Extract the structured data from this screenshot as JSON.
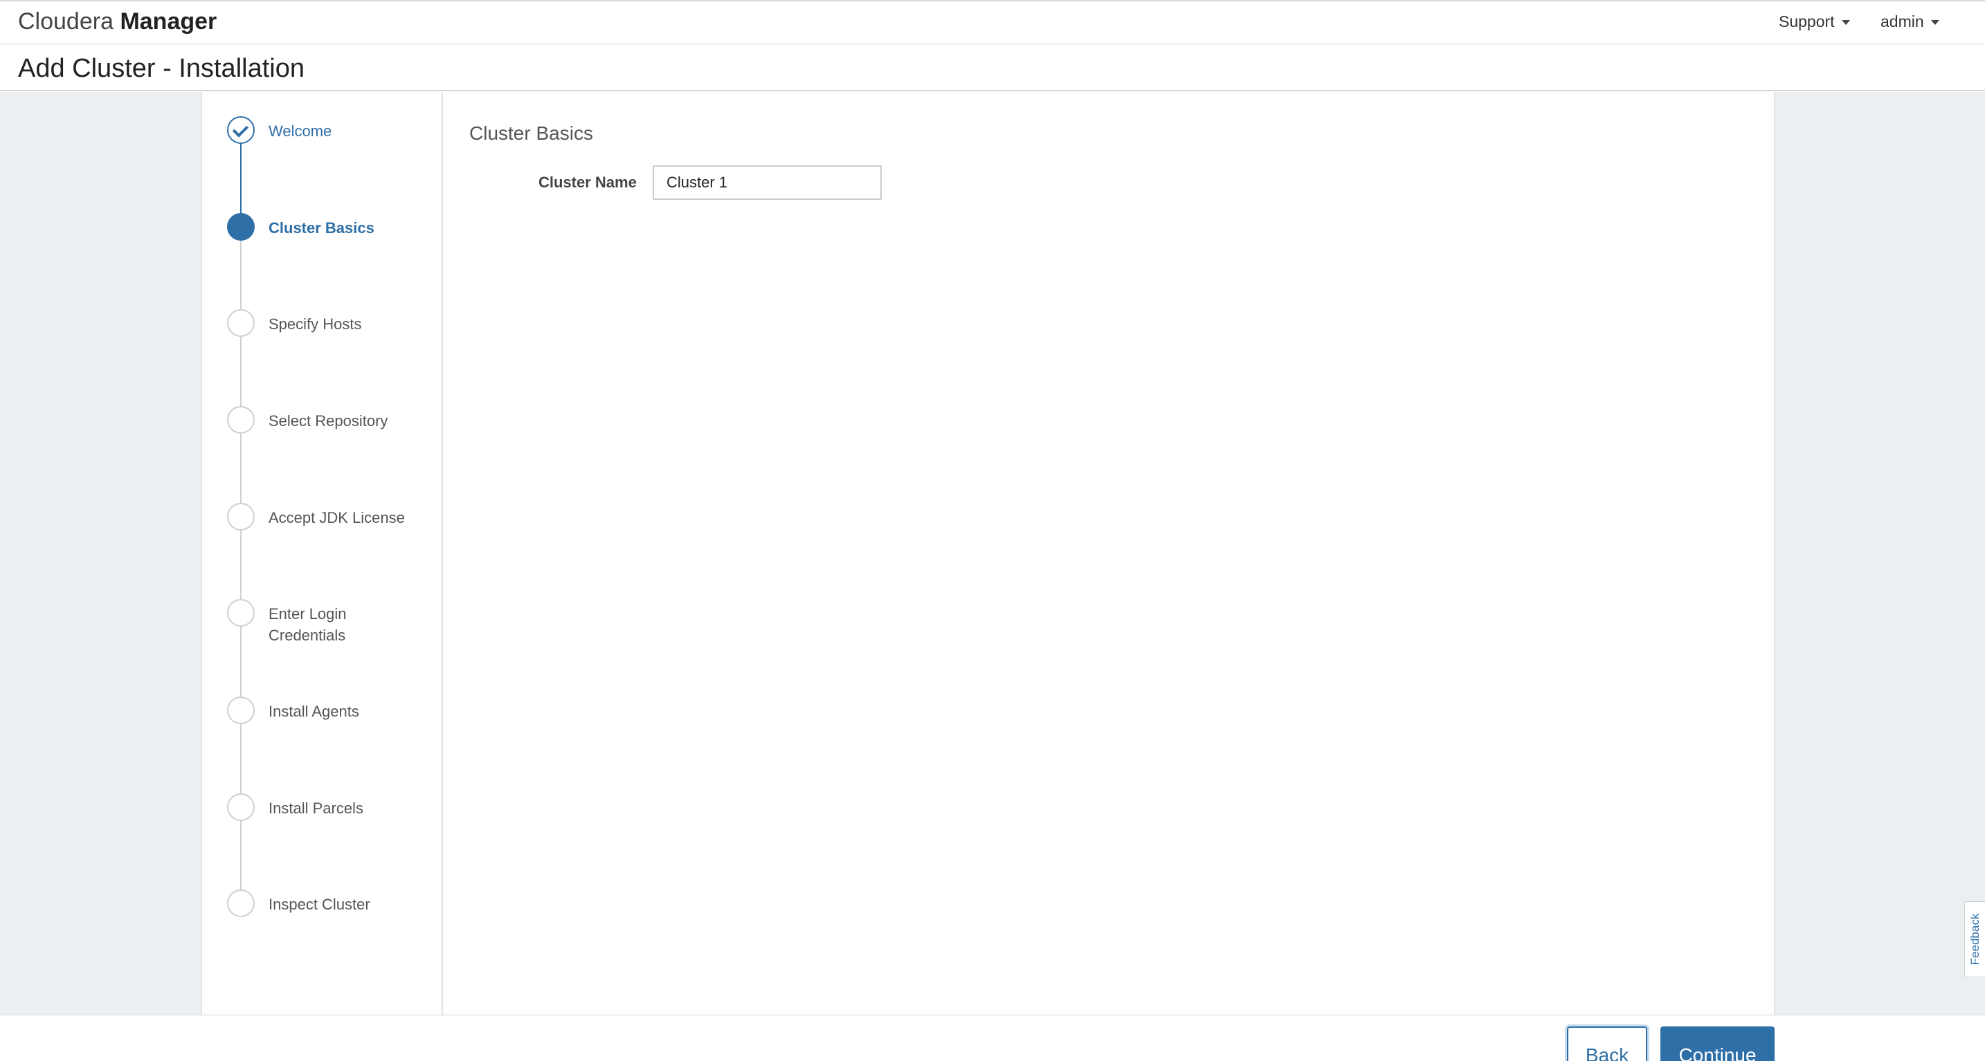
{
  "header": {
    "brand_light": "Cloudera",
    "brand_bold": "Manager",
    "support_label": "Support",
    "user_label": "admin"
  },
  "page_title": "Add Cluster - Installation",
  "wizard": {
    "steps": [
      {
        "label": "Welcome",
        "state": "done"
      },
      {
        "label": "Cluster Basics",
        "state": "active"
      },
      {
        "label": "Specify Hosts",
        "state": "pending"
      },
      {
        "label": "Select Repository",
        "state": "pending"
      },
      {
        "label": "Accept JDK License",
        "state": "pending"
      },
      {
        "label": "Enter Login Credentials",
        "state": "pending"
      },
      {
        "label": "Install Agents",
        "state": "pending"
      },
      {
        "label": "Install Parcels",
        "state": "pending"
      },
      {
        "label": "Inspect Cluster",
        "state": "pending"
      }
    ]
  },
  "content": {
    "section_title": "Cluster Basics",
    "cluster_name_label": "Cluster Name",
    "cluster_name_value": "Cluster 1"
  },
  "feedback_label": "Feedback",
  "footer": {
    "back_label": "Back",
    "continue_label": "Continue"
  },
  "colors": {
    "accent": "#2f6fa8",
    "body_background": "#eceff2"
  }
}
